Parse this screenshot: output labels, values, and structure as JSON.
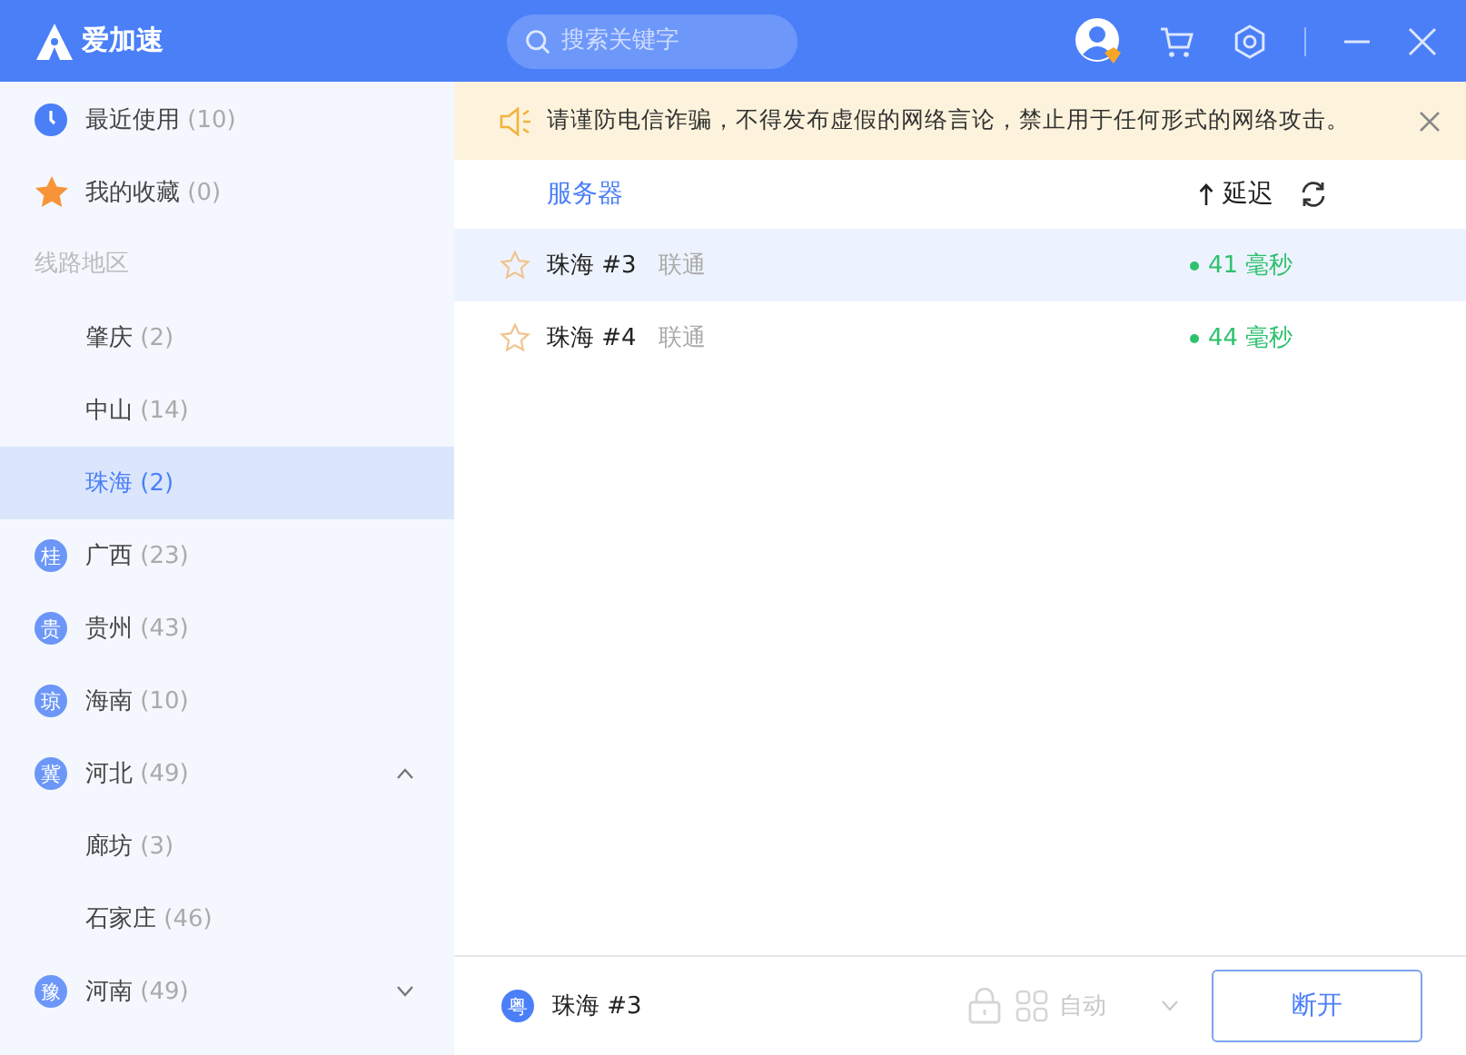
{
  "app": {
    "name": "爱加速"
  },
  "search": {
    "placeholder": "搜索关键字"
  },
  "sidebar": {
    "items": [
      {
        "kind": "recent",
        "label": "最近使用",
        "count": "(10)",
        "selected": false
      },
      {
        "kind": "favorites",
        "label": "我的收藏",
        "count": "(0)",
        "selected": false
      },
      {
        "kind": "header",
        "label": "线路地区"
      },
      {
        "kind": "city",
        "label": "肇庆",
        "count": "(2)",
        "selected": false
      },
      {
        "kind": "city",
        "label": "中山",
        "count": "(14)",
        "selected": false
      },
      {
        "kind": "city",
        "label": "珠海",
        "count": "(2)",
        "selected": true
      },
      {
        "kind": "province",
        "badge": "桂",
        "label": "广西",
        "count": "(23)",
        "selected": false
      },
      {
        "kind": "province",
        "badge": "贵",
        "label": "贵州",
        "count": "(43)",
        "selected": false
      },
      {
        "kind": "province",
        "badge": "琼",
        "label": "海南",
        "count": "(10)",
        "selected": false
      },
      {
        "kind": "province",
        "badge": "冀",
        "label": "河北",
        "count": "(49)",
        "selected": false,
        "expanded": true,
        "children": [
          {
            "kind": "city",
            "label": "廊坊",
            "count": "(3)",
            "selected": false
          },
          {
            "kind": "city",
            "label": "石家庄",
            "count": "(46)",
            "selected": false
          }
        ]
      },
      {
        "kind": "province",
        "badge": "豫",
        "label": "河南",
        "count": "(49)",
        "selected": false,
        "expanded": false
      }
    ]
  },
  "notice": {
    "text": "请谨防电信诈骗，不得发布虚假的网络言论，禁止用于任何形式的网络攻击。"
  },
  "table": {
    "columns": [
      "服务器",
      "延迟"
    ],
    "rows": [
      {
        "name": "珠海 #3",
        "isp": "联通",
        "latency": "41 毫秒",
        "selected": true
      },
      {
        "name": "珠海 #4",
        "isp": "联通",
        "latency": "44 毫秒",
        "selected": false
      }
    ]
  },
  "footer": {
    "badge": "粤",
    "server": "珠海 #3",
    "mode": "自动",
    "button": "断开"
  }
}
